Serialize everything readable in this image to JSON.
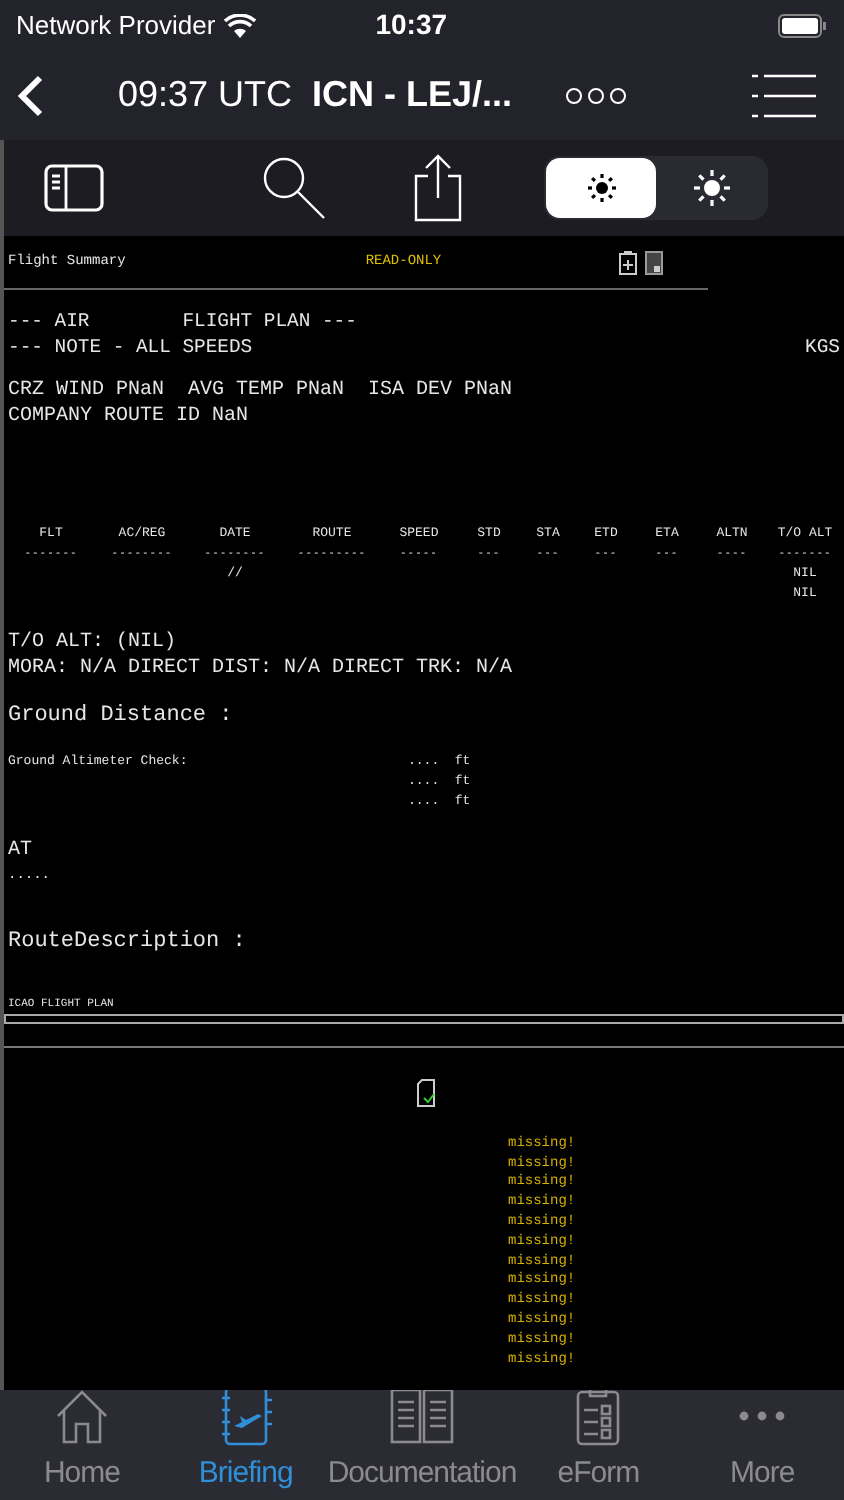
{
  "status_bar": {
    "carrier": "Network Provider",
    "time": "10:37"
  },
  "nav_bar": {
    "time": "09:37 UTC",
    "route": "ICN - LEJ/..."
  },
  "toolbar": {
    "brightness": [
      {
        "selected": true
      },
      {
        "selected": false
      }
    ]
  },
  "document": {
    "header": {
      "title": "Flight Summary",
      "status": "READ-ONLY"
    },
    "plan_lines": [
      "--- AIR        FLIGHT PLAN ---",
      "--- NOTE - ALL SPEEDS"
    ],
    "unit": "KGS",
    "info_lines": [
      "CRZ WIND PNaN  AVG TEMP PNaN  ISA DEV PNaN",
      "COMPANY ROUTE ID NaN"
    ],
    "table": {
      "columns": [
        {
          "header": "FLT",
          "rule": "-------"
        },
        {
          "header": "AC/REG",
          "rule": "--------"
        },
        {
          "header": "DATE",
          "rule": "--------",
          "values": [
            "//"
          ]
        },
        {
          "header": "ROUTE",
          "rule": "---------"
        },
        {
          "header": "SPEED",
          "rule": "-----"
        },
        {
          "header": "STD",
          "rule": "---"
        },
        {
          "header": "STA",
          "rule": "---"
        },
        {
          "header": "ETD",
          "rule": "---"
        },
        {
          "header": "ETA",
          "rule": "---"
        },
        {
          "header": "ALTN",
          "rule": "----"
        },
        {
          "header": "T/O ALT",
          "rule": "-------",
          "values": [
            "NIL",
            "NIL"
          ]
        }
      ]
    },
    "alt_lines": [
      "T/O ALT: (NIL)",
      "MORA: N/A DIRECT DIST: N/A DIRECT TRK: N/A"
    ],
    "ground_distance": "Ground Distance :",
    "altimeter_check": {
      "label": "Ground Altimeter Check:",
      "values": [
        "....  ft",
        "....  ft",
        "....  ft"
      ]
    },
    "atc": {
      "label": "AT",
      "value": "....."
    },
    "route_description": "RouteDescription :",
    "icao_title": "ICAO FLIGHT PLAN",
    "missing": [
      "missing!",
      "missing!",
      "missing!",
      "missing!",
      "missing!",
      "missing!",
      "missing!",
      "missing!",
      "missing!",
      "missing!",
      "missing!",
      "missing!"
    ]
  },
  "tab_bar": [
    {
      "label": "Home",
      "kind": "home",
      "selected": false
    },
    {
      "label": "Briefing",
      "kind": "briefing",
      "selected": true
    },
    {
      "label": "Documentation",
      "kind": "documentation",
      "selected": false
    },
    {
      "label": "eForm",
      "kind": "eform",
      "selected": false
    },
    {
      "label": "More",
      "kind": "more",
      "selected": false
    }
  ]
}
